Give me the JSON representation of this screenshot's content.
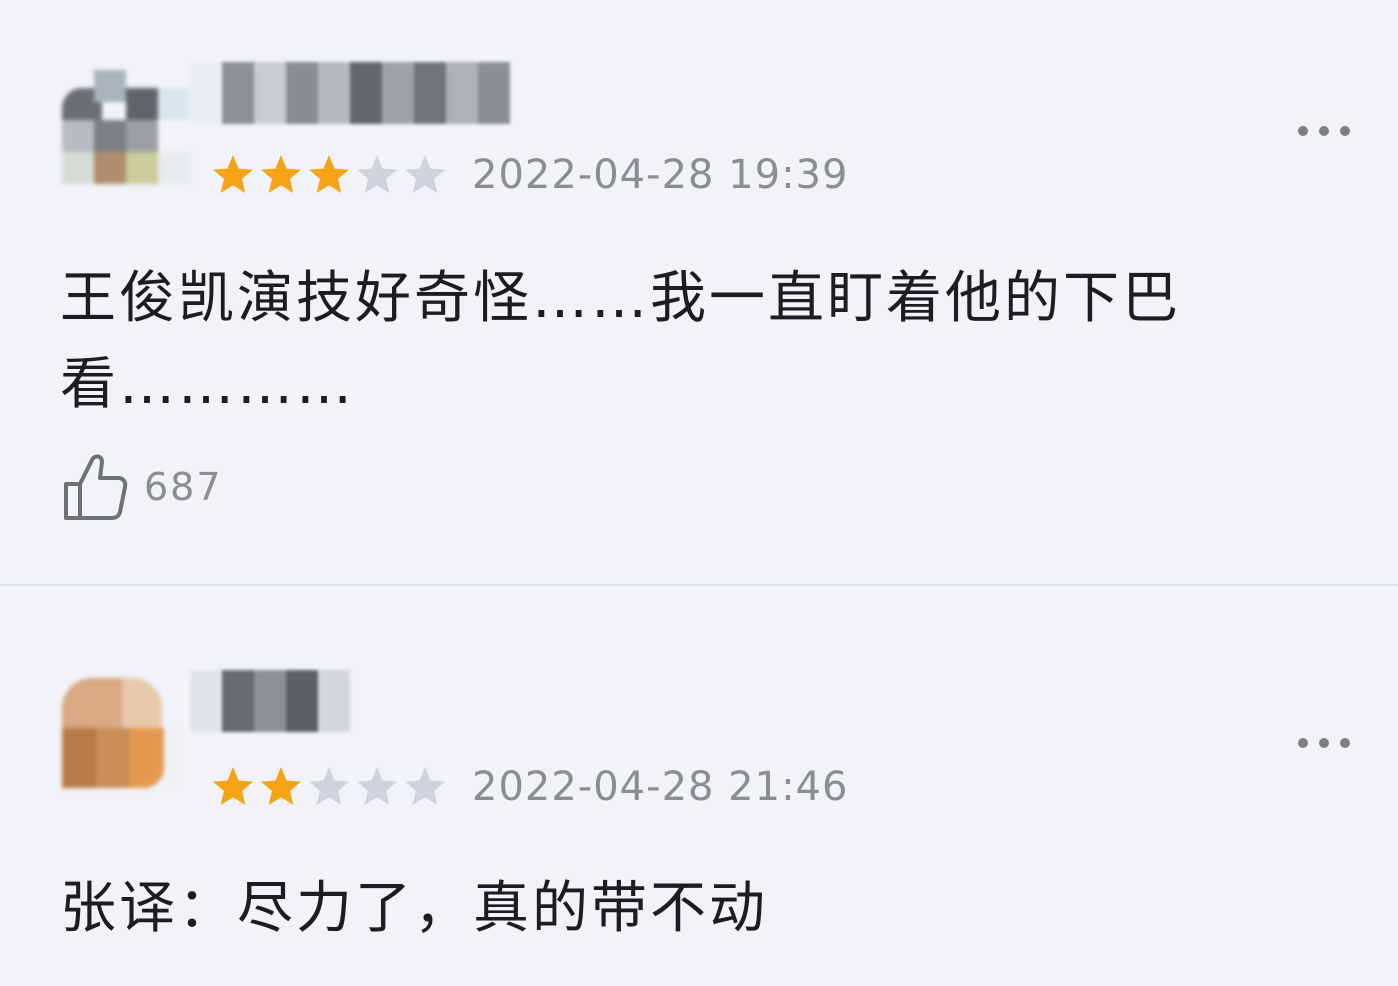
{
  "colors": {
    "background": "#f1f3f9",
    "star_filled": "#f6a417",
    "star_empty": "#cfd3db",
    "meta_text": "#8a8d93",
    "body_text": "#1c1d20"
  },
  "reviews": [
    {
      "rating": 3,
      "max_rating": 5,
      "date": "2022-04-28 19:39",
      "content": "王俊凯演技好奇怪……我一直盯着他的下巴看…………",
      "likes": "687",
      "like_icon": "thumbs-up-icon",
      "more_icon": "more-horizontal-icon"
    },
    {
      "rating": 2,
      "max_rating": 5,
      "date": "2022-04-28 21:46",
      "content": "张译：尽力了，真的带不动",
      "more_icon": "more-horizontal-icon"
    }
  ]
}
